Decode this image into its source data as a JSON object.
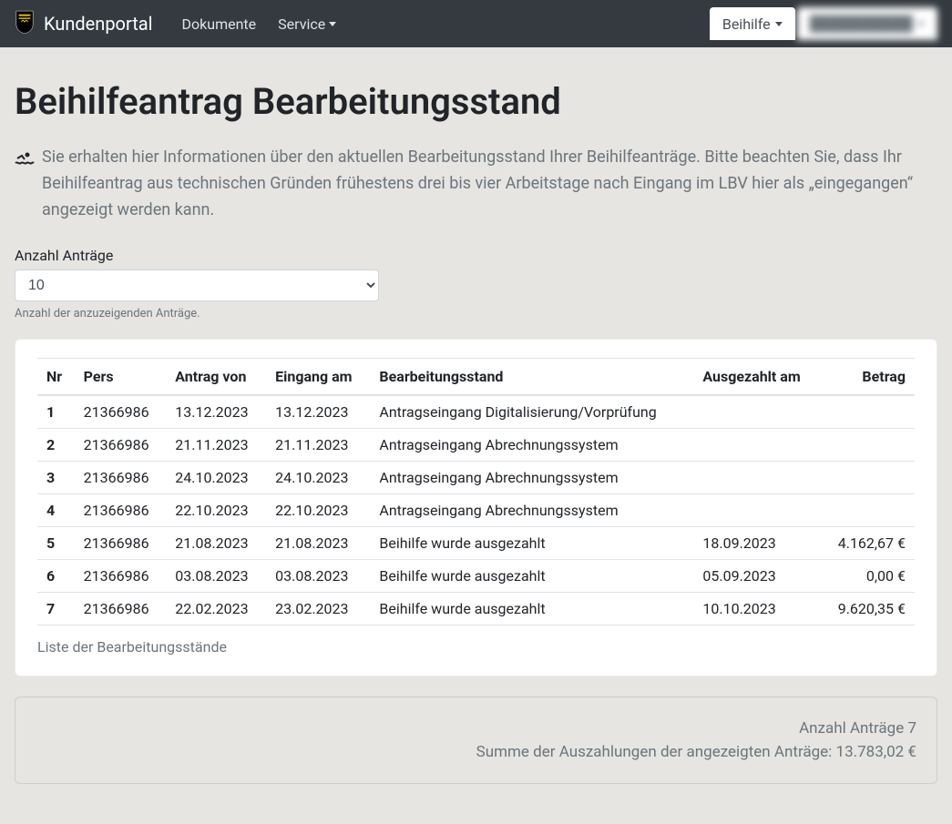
{
  "navbar": {
    "brand": "Kundenportal",
    "items": [
      {
        "label": "Dokumente",
        "has_dropdown": false
      },
      {
        "label": "Service",
        "has_dropdown": true
      }
    ],
    "right_tabs": [
      {
        "label": "Beihilfe",
        "has_dropdown": true,
        "active": true
      },
      {
        "label": "██████████",
        "has_dropdown": true,
        "user": true
      }
    ]
  },
  "page": {
    "title": "Beihilfeantrag Bearbeitungsstand",
    "intro": "Sie erhalten hier Informationen über den aktuellen Bearbeitungsstand Ihrer Beihilfeanträge. Bitte beachten Sie, dass Ihr Beihilfeantrag aus technischen Gründen frühestens drei bis vier Arbeitstage nach Eingang im LBV hier als „eingegangen“ angezeigt werden kann."
  },
  "filter": {
    "label": "Anzahl Anträge",
    "selected": "10",
    "help": "Anzahl der anzuzeigenden Anträge."
  },
  "table": {
    "columns": {
      "nr": "Nr",
      "pers": "Pers",
      "antrag_von": "Antrag von",
      "eingang_am": "Eingang am",
      "bearbeitungsstand": "Bearbeitungsstand",
      "ausgezahlt_am": "Ausgezahlt am",
      "betrag": "Betrag"
    },
    "rows": [
      {
        "nr": "1",
        "pers": "21366986",
        "antrag_von": "13.12.2023",
        "eingang_am": "13.12.2023",
        "bearbeitungsstand": "Antragseingang Digitalisierung/Vorprüfung",
        "ausgezahlt_am": "",
        "betrag": ""
      },
      {
        "nr": "2",
        "pers": "21366986",
        "antrag_von": "21.11.2023",
        "eingang_am": "21.11.2023",
        "bearbeitungsstand": "Antragseingang Abrechnungssystem",
        "ausgezahlt_am": "",
        "betrag": ""
      },
      {
        "nr": "3",
        "pers": "21366986",
        "antrag_von": "24.10.2023",
        "eingang_am": "24.10.2023",
        "bearbeitungsstand": "Antragseingang Abrechnungssystem",
        "ausgezahlt_am": "",
        "betrag": ""
      },
      {
        "nr": "4",
        "pers": "21366986",
        "antrag_von": "22.10.2023",
        "eingang_am": "22.10.2023",
        "bearbeitungsstand": "Antragseingang Abrechnungssystem",
        "ausgezahlt_am": "",
        "betrag": ""
      },
      {
        "nr": "5",
        "pers": "21366986",
        "antrag_von": "21.08.2023",
        "eingang_am": "21.08.2023",
        "bearbeitungsstand": "Beihilfe wurde ausgezahlt",
        "ausgezahlt_am": "18.09.2023",
        "betrag": "4.162,67 €"
      },
      {
        "nr": "6",
        "pers": "21366986",
        "antrag_von": "03.08.2023",
        "eingang_am": "03.08.2023",
        "bearbeitungsstand": "Beihilfe wurde ausgezahlt",
        "ausgezahlt_am": "05.09.2023",
        "betrag": "0,00 €"
      },
      {
        "nr": "7",
        "pers": "21366986",
        "antrag_von": "22.02.2023",
        "eingang_am": "23.02.2023",
        "bearbeitungsstand": "Beihilfe wurde ausgezahlt",
        "ausgezahlt_am": "10.10.2023",
        "betrag": "9.620,35 €"
      }
    ],
    "footer": "Liste der Bearbeitungsstände"
  },
  "summary": {
    "count_label": "Anzahl Anträge 7",
    "sum_label": "Summe der Auszahlungen der angezeigten Anträge: 13.783,02 €"
  }
}
